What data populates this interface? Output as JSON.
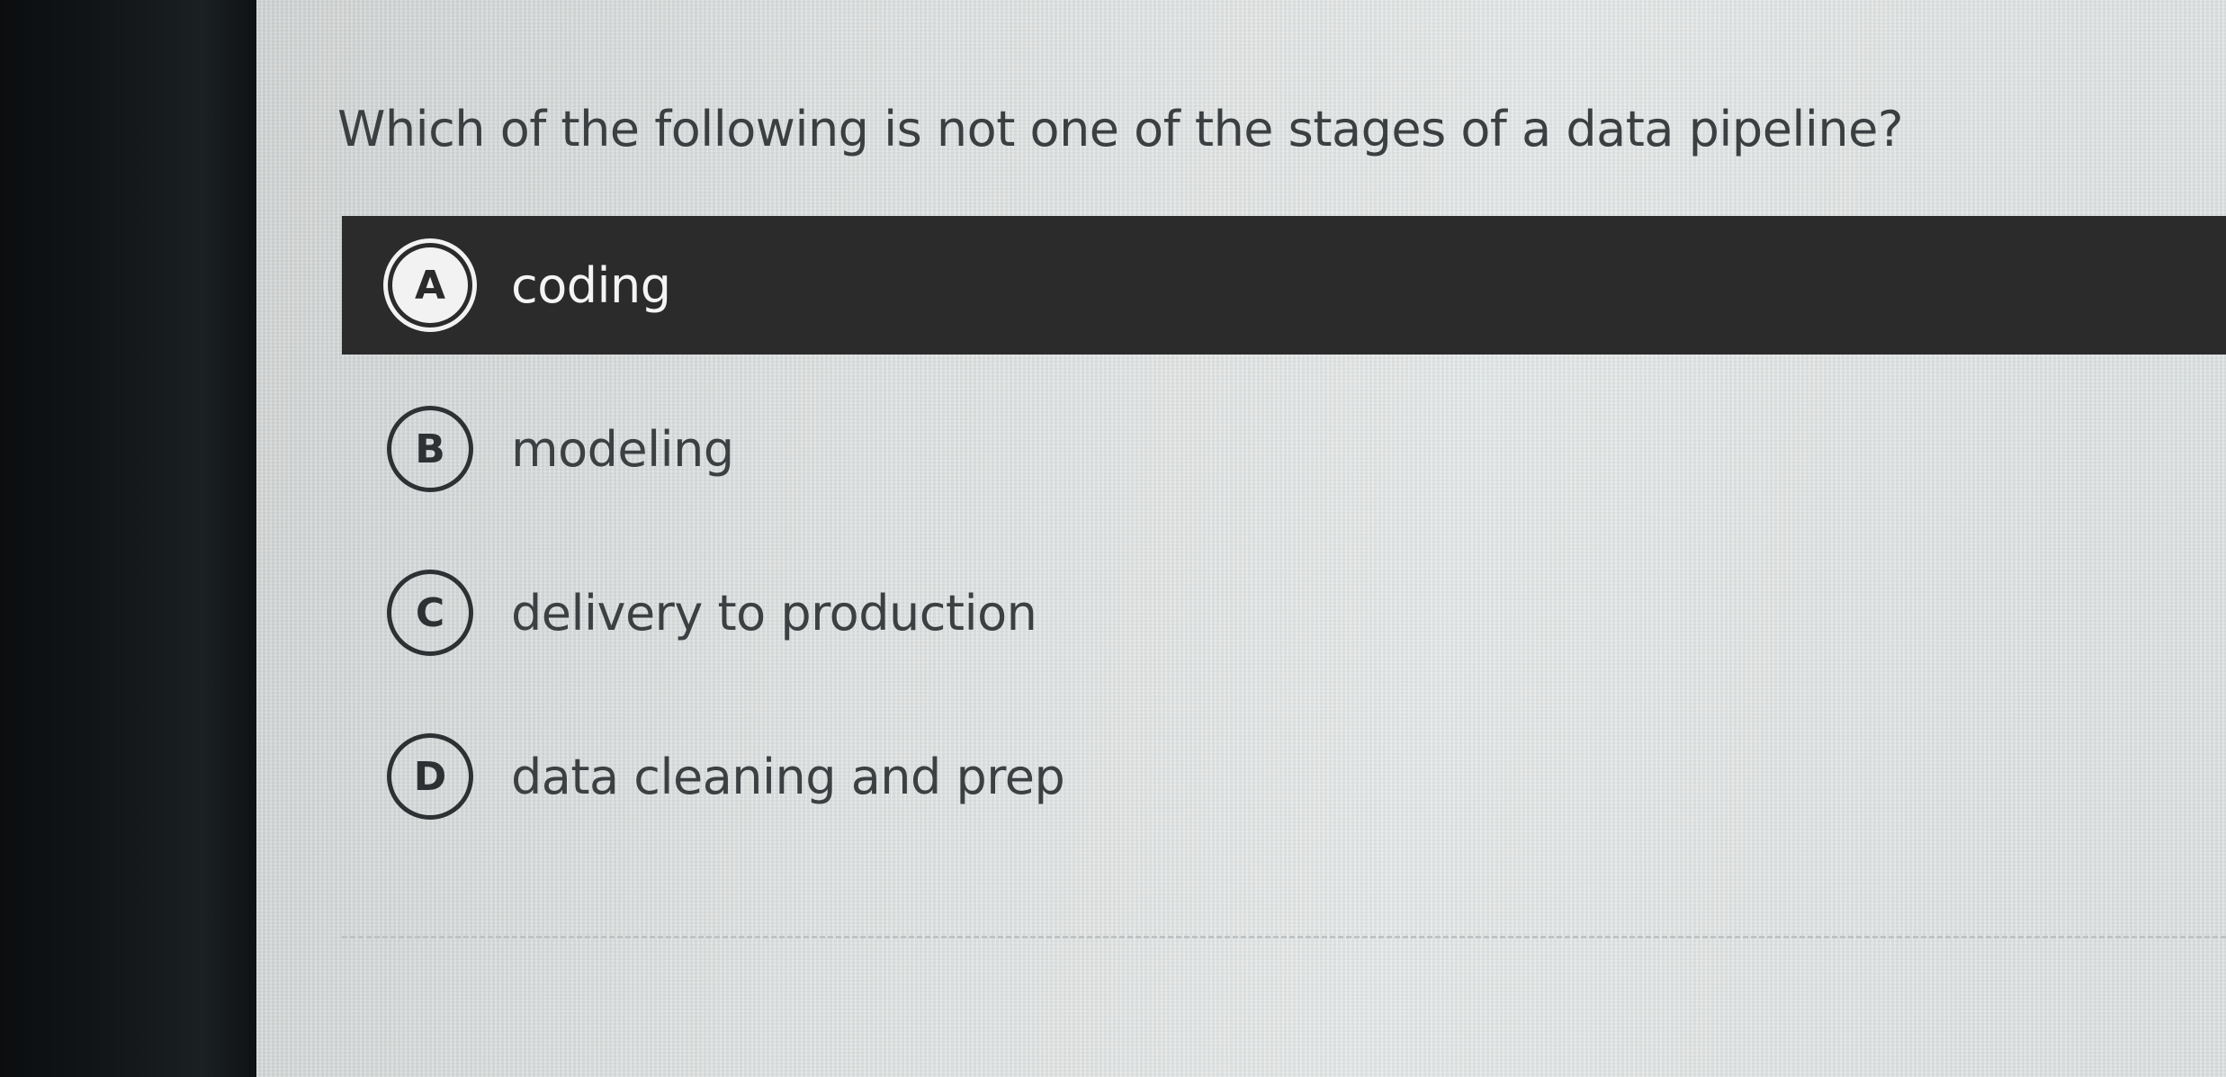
{
  "quiz": {
    "question": "Which of the following is not one of the stages of a data pipeline?",
    "options": [
      {
        "letter": "A",
        "text": "coding",
        "selected": true
      },
      {
        "letter": "B",
        "text": "modeling",
        "selected": false
      },
      {
        "letter": "C",
        "text": "delivery to production",
        "selected": false
      },
      {
        "letter": "D",
        "text": "data cleaning and prep",
        "selected": false
      }
    ]
  },
  "colors": {
    "selected_background": "#2b2b2b",
    "selected_text": "#f4f4f4",
    "text": "#3d4042",
    "screen_background": "#e0e3e3",
    "bezel": "#111417"
  }
}
